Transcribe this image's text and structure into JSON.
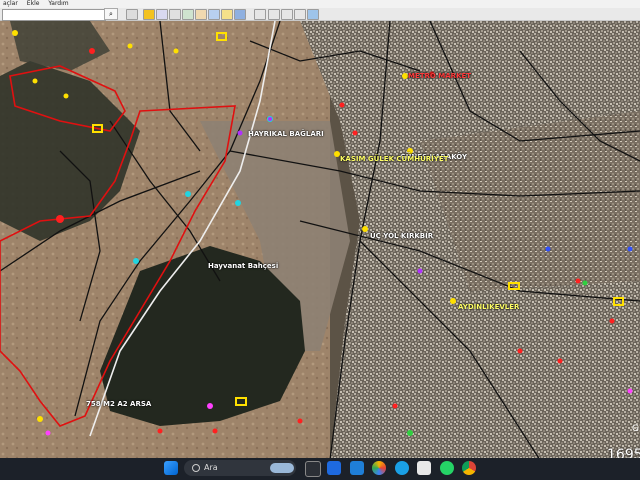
{
  "menu": {
    "items": [
      "açlar",
      "Ekle",
      "Yardım"
    ]
  },
  "search": {
    "placeholder": ""
  },
  "map": {
    "labels": [
      {
        "text": "METRO MARKET",
        "color": "#ff3b3b"
      },
      {
        "text": "HAYRIKAL BAĞLARI",
        "color": "#ffffff"
      },
      {
        "text": "GÜNEŞ KARAKÖY",
        "color": "#ffffff"
      },
      {
        "text": "KASIM GÜLEK CUMHURİYET",
        "color": "#ffff66"
      },
      {
        "text": "ÜÇ YOL KIRKBIR",
        "color": "#ffffff"
      },
      {
        "text": "Hayvanat Bahçesi",
        "color": "#ffffff"
      },
      {
        "text": "AYDINLIKEVLER",
        "color": "#ffff66"
      },
      {
        "text": "758 M2 A2 ARSA",
        "color": "#ffffff"
      }
    ]
  },
  "statusbar": {
    "coordinate_fragment": "1695",
    "copyright_fragment": "G"
  },
  "taskbar": {
    "search_label": "Ara",
    "icons": [
      "windows-start-icon",
      "widgets-icon",
      "task-view-icon",
      "google-earth-icon",
      "photos-icon",
      "edge-icon",
      "store-icon",
      "whatsapp-icon",
      "steam-icon",
      "chrome-icon"
    ]
  },
  "colors": {
    "map_base": "#5a4e40",
    "boundary_red": "#e01010",
    "road_black": "#111111",
    "taskbar": "#1c2129"
  }
}
